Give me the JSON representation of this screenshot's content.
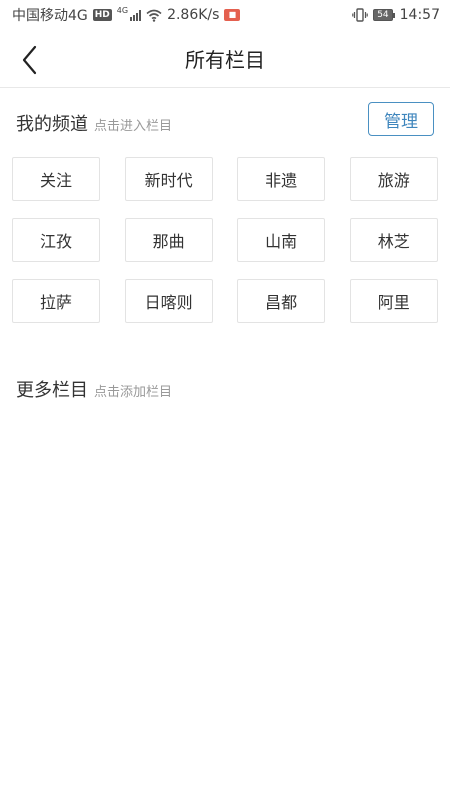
{
  "status_bar": {
    "carrier": "中国移动4G",
    "hd_badge": "HD",
    "network_type": "4G",
    "speed": "2.86K/s",
    "battery": "54",
    "time": "14:57",
    "icons": [
      "hd-icon",
      "signal-icon",
      "wifi-icon",
      "app-notification-icon",
      "vibrate-icon",
      "battery-icon"
    ]
  },
  "nav": {
    "title": "所有栏目",
    "back_icon": "chevron-left-icon"
  },
  "my_channels": {
    "title": "我的频道",
    "hint": "点击进入栏目",
    "manage_label": "管理",
    "items": [
      {
        "label": "关注"
      },
      {
        "label": "新时代"
      },
      {
        "label": "非遗"
      },
      {
        "label": "旅游"
      },
      {
        "label": "江孜"
      },
      {
        "label": "那曲"
      },
      {
        "label": "山南"
      },
      {
        "label": "林芝"
      },
      {
        "label": "拉萨"
      },
      {
        "label": "日喀则"
      },
      {
        "label": "昌都"
      },
      {
        "label": "阿里"
      }
    ]
  },
  "more_channels": {
    "title": "更多栏目",
    "hint": "点击添加栏目"
  },
  "colors": {
    "accent": "#3f86bd",
    "border": "#e3e3e3",
    "hint_text": "#999999"
  }
}
